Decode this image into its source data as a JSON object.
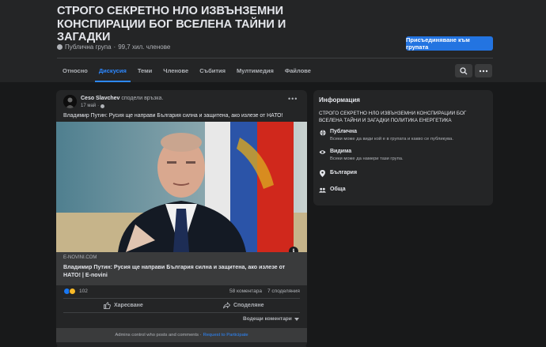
{
  "group": {
    "title": "СТРОГО СЕКРЕТНО НЛО ИЗВЪНЗЕМНИ КОНСПИРАЦИИ БОГ ВСЕЛЕНА ТАЙНИ И ЗАГАДКИ",
    "privacy": "Публична група",
    "members": "99,7 хил. членове",
    "join_label": "Присъединяване към групата"
  },
  "tabs": [
    "Относно",
    "Дискусия",
    "Теми",
    "Членове",
    "Събития",
    "Мултимедия",
    "Файлове"
  ],
  "active_tab": "Дискусия",
  "post": {
    "author": "Ceso Slavchev",
    "action_text": "сподели връзка.",
    "date": "17 май",
    "text": "Владимир Путин: Русия ще направи България силна и защитена, ако излезе от НАТО!",
    "link": {
      "domain": "E-NOVINI.COM",
      "title": "Владимир Путин: Русия ще направи България силна и защитена, ако излезе от НАТО! | E-novini"
    },
    "reactions_count": "102",
    "comments_count": "58 коментара",
    "shares_count": "7 споделяния",
    "like_label": "Харесване",
    "share_label": "Споделяне",
    "sort_label": "Водещи коментари",
    "admins_text": "Admins control who posts and comments ·",
    "request_label": "Request to Participate"
  },
  "info": {
    "title": "Информация",
    "description": "СТРОГО СЕКРЕТНО НЛО ИЗВЪНЗЕМНИ КОНСПИРАЦИИ БОГ ВСЕЛЕНА ТАЙНИ И ЗАГАДКИ ПОЛИТИКА ЕНЕРГЕТИКА",
    "public_label": "Публична",
    "public_desc": "Всеки може да види кой е в групата и какво се публикува.",
    "visible_label": "Видима",
    "visible_desc": "Всеки може да намери тази група.",
    "country": "България",
    "general": "Обща"
  },
  "colors": {
    "accent": "#2d88ff",
    "join_button": "#2374e1",
    "background": "#18191a",
    "card": "#242526"
  },
  "icons": [
    "globe-icon",
    "search-icon",
    "more-icon",
    "info-icon",
    "like-icon",
    "share-icon",
    "eye-icon",
    "pin-icon",
    "people-icon",
    "chevron-down-icon"
  ]
}
